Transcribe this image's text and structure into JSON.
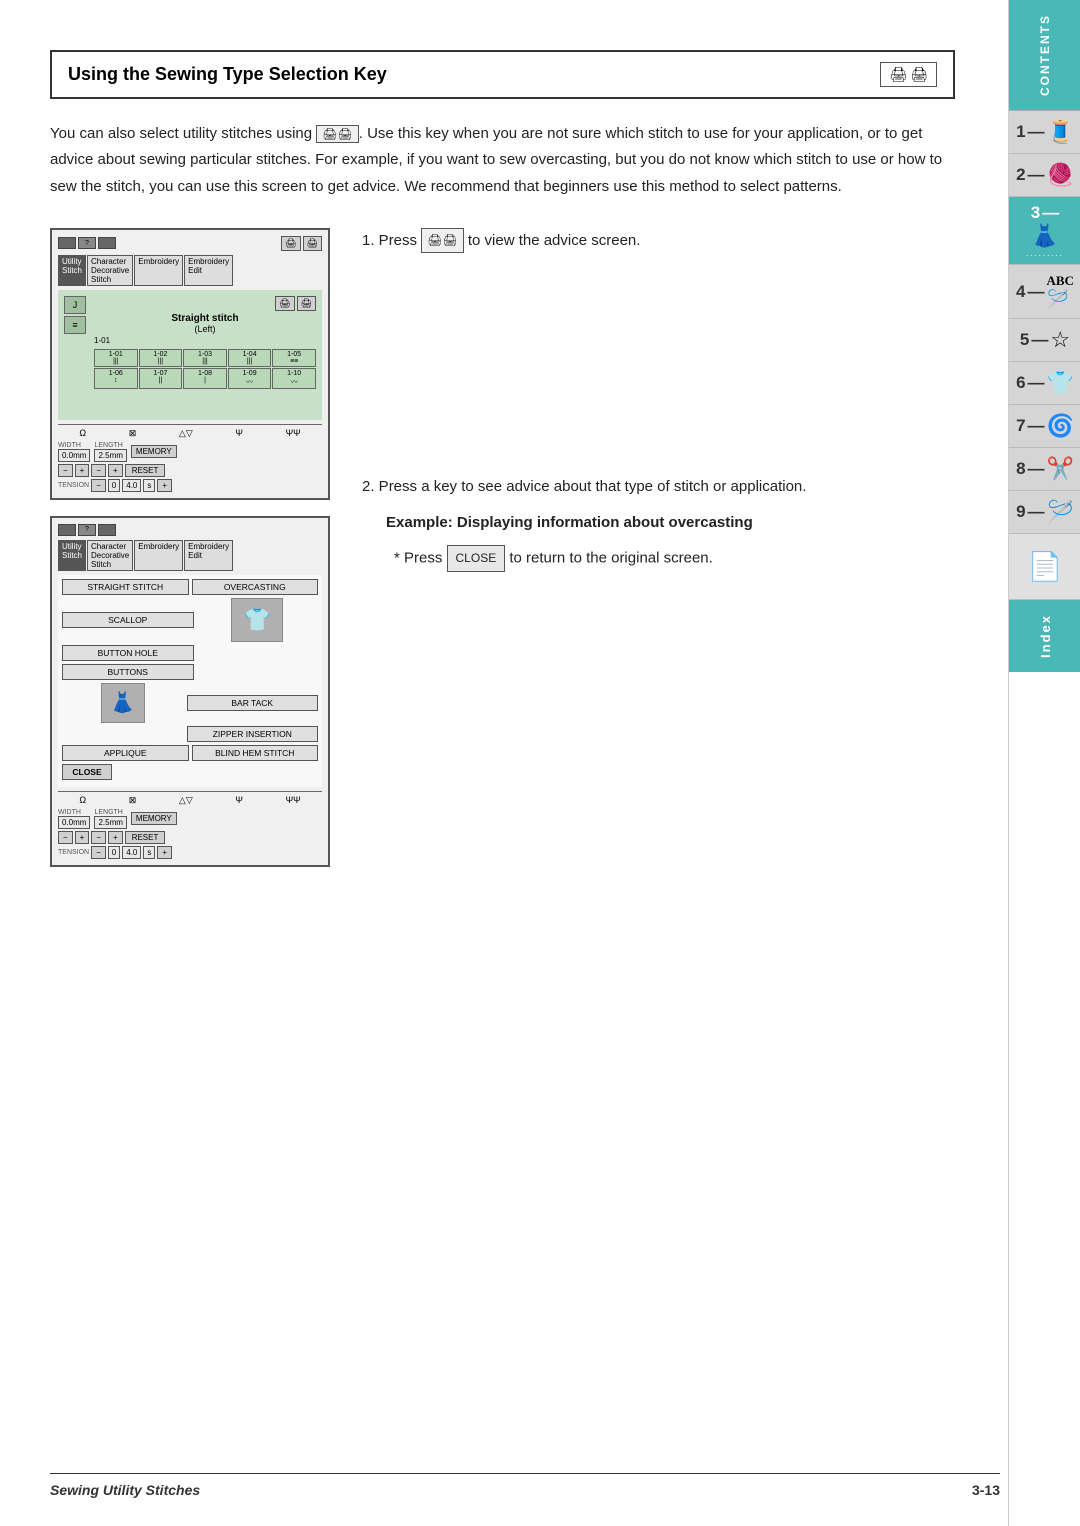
{
  "title": "Using the Sewing Type Selection Key",
  "title_icons": "🖨️ 🖨️",
  "intro": "You can also select utility stitches using . Use this key when you are not sure which stitch to use for your application, or to get advice about sewing particular stitches. For example, if you want to sew overcasting, but you do not know which stitch to use or how to sew the stitch, you can use this screen to get advice. We recommend that beginners use this method to select patterns.",
  "step1": {
    "number": "1.",
    "text": "Press",
    "action": " to view the advice screen.",
    "btn_icon": "🖨️"
  },
  "step2": {
    "number": "2.",
    "text": "Press a key to see advice about that type of stitch or application.",
    "example_label": "Example:",
    "example_desc": "Displaying information about overcasting",
    "return_text": "Press",
    "close_label": "CLOSE",
    "return_end": "to return to the original screen."
  },
  "screen1": {
    "tabs": [
      "Utility Stitch",
      "Character Decorative Stitch",
      "Embroidery",
      "Embroidery Edit"
    ],
    "stitch_name": "Straight stitch",
    "stitch_sub": "(Left)",
    "stitch_id": "1-01",
    "cells": [
      {
        "id": "1-01",
        "sym": "🔧"
      },
      {
        "id": "1-02",
        "sym": "🔧"
      },
      {
        "id": "1-03",
        "sym": "🔧"
      },
      {
        "id": "1-04",
        "sym": "🔧"
      },
      {
        "id": "1-05",
        "sym": "🔧"
      },
      {
        "id": "1-06",
        "sym": "🔧"
      },
      {
        "id": "1-07",
        "sym": "🔧"
      },
      {
        "id": "1-08",
        "sym": "🔧"
      },
      {
        "id": "1-09",
        "sym": "〰"
      },
      {
        "id": "1-10",
        "sym": "〰"
      }
    ]
  },
  "screen2": {
    "tabs": [
      "Utility Stitch",
      "Character Decorative Stitch",
      "Embroidery",
      "Embroidery Edit"
    ],
    "menu_items": [
      "STRAIGHT STITCH",
      "OVERCASTING",
      "SCALLOP",
      "",
      "BUTTON HOLE",
      "",
      "BUTTONS",
      "",
      "",
      "BAR TACK",
      "",
      "ZIPPER INSERTION",
      "APPLIQUE",
      "BLIND HEM STITCH",
      "CLOSE",
      ""
    ],
    "width_label": "WIDTH",
    "width_val": "0.0 mm",
    "length_label": "LENGTH",
    "length_val": "2.5 mm",
    "memory_label": "MEMORY",
    "reset_label": "RESET",
    "tension_label": "TENSION",
    "tension_val": "4.0"
  },
  "footer": {
    "left": "Sewing Utility Stitches",
    "right": "3-13"
  },
  "sidebar": {
    "contents": "CONTENTS",
    "tabs": [
      {
        "num": "1",
        "icon": "🧵"
      },
      {
        "num": "2",
        "icon": "🧶"
      },
      {
        "num": "3",
        "icon": "👗",
        "dots": true
      },
      {
        "num": "4",
        "icon": "ABC"
      },
      {
        "num": "5",
        "icon": "⭐"
      },
      {
        "num": "6",
        "icon": "👕"
      },
      {
        "num": "7",
        "icon": "👘"
      },
      {
        "num": "8",
        "icon": "🪡"
      },
      {
        "num": "9",
        "icon": "🧵"
      }
    ],
    "index": "Index"
  }
}
